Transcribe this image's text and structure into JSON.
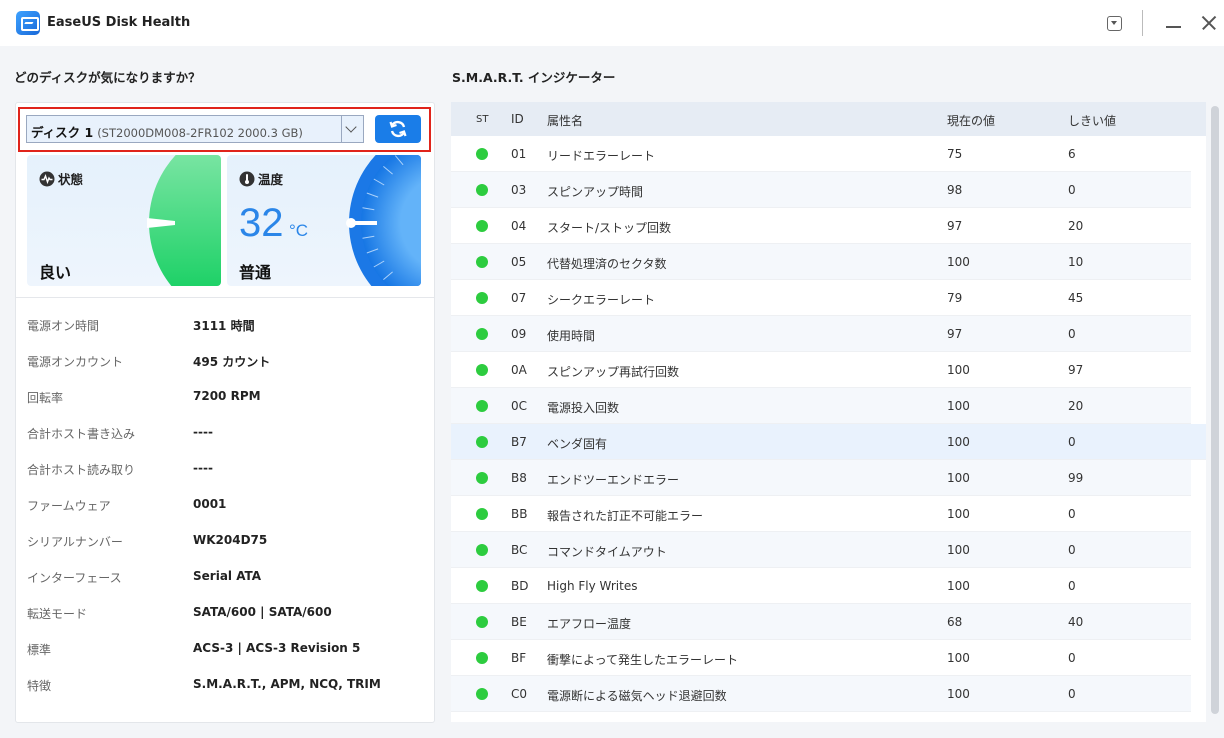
{
  "app": {
    "title": "EaseUS Disk Health"
  },
  "left": {
    "heading": "どのディスクが気になりますか？",
    "disk_select": {
      "name": "ディスク 1",
      "model": "(ST2000DM008-2FR102 2000.3 GB)"
    },
    "status_card": {
      "label": "状態",
      "value": "良い",
      "icon": "heartbeat-icon",
      "color": "#0fcf5c"
    },
    "temp_card": {
      "label": "温度",
      "temperature": "32",
      "unit": "°C",
      "value": "普通",
      "icon": "thermometer-icon",
      "color": "#1a7de8"
    },
    "info": [
      {
        "key": "電源オン時間",
        "value": "3111 時間"
      },
      {
        "key": "電源オンカウント",
        "value": "495 カウント"
      },
      {
        "key": "回転率",
        "value": "7200 RPM"
      },
      {
        "key": "合計ホスト書き込み",
        "value": "----"
      },
      {
        "key": "合計ホスト読み取り",
        "value": "----"
      },
      {
        "key": "ファームウェア",
        "value": "0001"
      },
      {
        "key": "シリアルナンバー",
        "value": "WK204D75"
      },
      {
        "key": "インターフェース",
        "value": "Serial ATA"
      },
      {
        "key": "転送モード",
        "value": "SATA/600 | SATA/600"
      },
      {
        "key": "標準",
        "value": "ACS-3 | ACS-3 Revision 5"
      },
      {
        "key": "特徴",
        "value": "S.M.A.R.T., APM, NCQ, TRIM"
      }
    ]
  },
  "smart": {
    "heading": "S.M.A.R.T. インジケーター",
    "columns": {
      "st": "ST",
      "id": "ID",
      "name": "属性名",
      "current": "現在の値",
      "threshold": "しきい値"
    },
    "status_color": "#2dcc3f",
    "rows": [
      {
        "id": "01",
        "name": "リードエラーレート",
        "current": "75",
        "threshold": "6"
      },
      {
        "id": "03",
        "name": "スピンアップ時間",
        "current": "98",
        "threshold": "0"
      },
      {
        "id": "04",
        "name": "スタート/ストップ回数",
        "current": "97",
        "threshold": "20"
      },
      {
        "id": "05",
        "name": "代替処理済のセクタ数",
        "current": "100",
        "threshold": "10"
      },
      {
        "id": "07",
        "name": "シークエラーレート",
        "current": "79",
        "threshold": "45"
      },
      {
        "id": "09",
        "name": "使用時間",
        "current": "97",
        "threshold": "0"
      },
      {
        "id": "0A",
        "name": "スピンアップ再試行回数",
        "current": "100",
        "threshold": "97"
      },
      {
        "id": "0C",
        "name": "電源投入回数",
        "current": "100",
        "threshold": "20"
      },
      {
        "id": "B7",
        "name": "ベンダ固有",
        "current": "100",
        "threshold": "0"
      },
      {
        "id": "B8",
        "name": "エンドツーエンドエラー",
        "current": "100",
        "threshold": "99"
      },
      {
        "id": "BB",
        "name": "報告された訂正不可能エラー",
        "current": "100",
        "threshold": "0"
      },
      {
        "id": "BC",
        "name": "コマンドタイムアウト",
        "current": "100",
        "threshold": "0"
      },
      {
        "id": "BD",
        "name": "High Fly Writes",
        "current": "100",
        "threshold": "0"
      },
      {
        "id": "BE",
        "name": "エアフロー温度",
        "current": "68",
        "threshold": "40"
      },
      {
        "id": "BF",
        "name": "衝撃によって発生したエラーレート",
        "current": "100",
        "threshold": "0"
      },
      {
        "id": "C0",
        "name": "電源断による磁気ヘッド退避回数",
        "current": "100",
        "threshold": "0"
      }
    ]
  }
}
